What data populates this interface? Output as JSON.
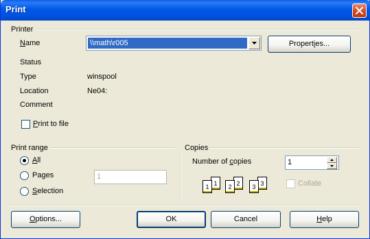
{
  "window": {
    "title": "Print"
  },
  "printer": {
    "group_label": "Printer",
    "name_label": "Name",
    "name_value": "\\\\math\\r005",
    "properties_button": "Properties...",
    "status_label": "Status",
    "status_value": "",
    "type_label": "Type",
    "type_value": "winspool",
    "location_label": "Location",
    "location_value": "Ne04:",
    "comment_label": "Comment",
    "comment_value": "",
    "print_to_file_label": "Print to file",
    "print_to_file_checked": false
  },
  "print_range": {
    "group_label": "Print range",
    "options": [
      {
        "label": "All",
        "selected": true
      },
      {
        "label": "Pages",
        "selected": false
      },
      {
        "label": "Selection",
        "selected": false
      }
    ],
    "pages_value": "1"
  },
  "copies": {
    "group_label": "Copies",
    "number_label": "Number of copies",
    "number_value": "1",
    "collate_label": "Collate",
    "collate_checked": false,
    "collate_enabled": false,
    "illustration_pages": [
      "1",
      "1",
      "2",
      "2",
      "3",
      "3"
    ]
  },
  "buttons": {
    "options": "Options...",
    "ok": "OK",
    "cancel": "Cancel",
    "help": "Help"
  },
  "colors": {
    "titlebar": "#0054e3",
    "dialog_bg": "#ece9d8",
    "selection": "#316ac5",
    "close_button": "#d2431e"
  }
}
